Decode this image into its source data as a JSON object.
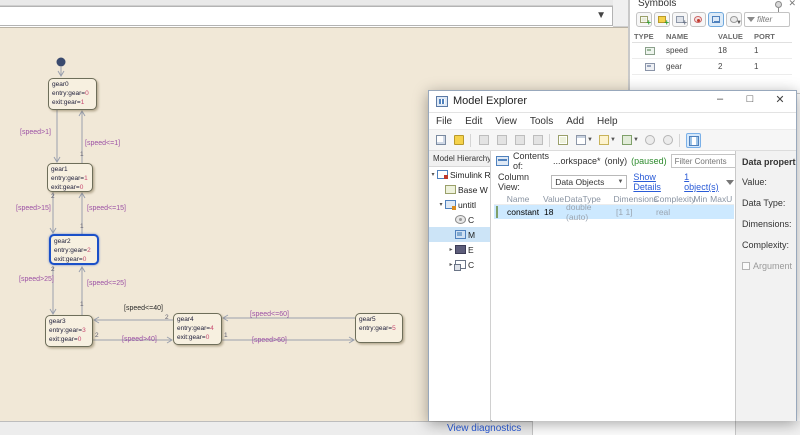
{
  "editor": {
    "status_link": "View diagnostics"
  },
  "chart": {
    "states": [
      {
        "title": "gear0",
        "l1": "entry:gear=",
        "v1": "0",
        "l2": "exit:gear=",
        "v2": "1"
      },
      {
        "title": "gear1",
        "l1": "entry:gear=",
        "v1": "1",
        "l2": "exit:gear=",
        "v2": "0"
      },
      {
        "title": "gear2",
        "l1": "entry:gear=",
        "v1": "2",
        "l2": "exit:gear=",
        "v2": "0"
      },
      {
        "title": "gear3",
        "l1": "entry:gear=",
        "v1": "3",
        "l2": "exit:gear=",
        "v2": "0"
      },
      {
        "title": "gear4",
        "l1": "entry:gear=",
        "v1": "4",
        "l2": "exit:gear=",
        "v2": "0"
      },
      {
        "title": "gear5",
        "l1": "entry:gear=",
        "v1": "5"
      }
    ],
    "transitions": [
      {
        "label": "[speed>1]"
      },
      {
        "label": "[speed<=1]"
      },
      {
        "label": "[speed>15]"
      },
      {
        "label": "[speed<=15]"
      },
      {
        "label": "[speed>25]"
      },
      {
        "label": "[speed<=25]"
      },
      {
        "label": "[speed<=40]"
      },
      {
        "label": "[speed>40]"
      },
      {
        "label": "[speed<=60]"
      },
      {
        "label": "[speed>60]"
      }
    ],
    "order_numbers": [
      "1",
      "2",
      "1",
      "2",
      "1",
      "2",
      "2",
      "1"
    ]
  },
  "symbols": {
    "title": "Symbols",
    "filter_placeholder": "filter",
    "columns": [
      "TYPE",
      "NAME",
      "VALUE",
      "PORT"
    ],
    "rows": [
      {
        "name": "speed",
        "value": "18",
        "port": "1"
      },
      {
        "name": "gear",
        "value": "2",
        "port": "1"
      }
    ]
  },
  "model_explorer": {
    "title": "Model Explorer",
    "controls": {
      "minimize": "–",
      "maximize": "□",
      "close": "✕"
    },
    "menus": [
      "File",
      "Edit",
      "View",
      "Tools",
      "Add",
      "Help"
    ],
    "hierarchy_title": "Model Hierarchy »",
    "tree": [
      {
        "label": "Simulink R"
      },
      {
        "label": "Base W"
      },
      {
        "label": "untitl"
      },
      {
        "label": "C"
      },
      {
        "label": "M"
      },
      {
        "label": "E"
      },
      {
        "label": "C"
      }
    ],
    "contents": {
      "label": "Contents of:",
      "scope": "...orkspace*",
      "only": "(only)",
      "paused": "(paused)",
      "filter_placeholder": "Filter Contents",
      "column_view_label": "Column View:",
      "column_view_value": "Data Objects",
      "show_details": "Show Details",
      "object_count": "1 object(s)",
      "columns": [
        "Name",
        "Value",
        "DataType",
        "Dimensions",
        "Complexity",
        "Min",
        "Max",
        "U"
      ],
      "rows": [
        {
          "name": "constant",
          "value": "18",
          "datatype": "double (auto)",
          "dimensions": "[1 1]",
          "complexity": "real"
        }
      ]
    },
    "properties": {
      "title": "Data properti",
      "fields": [
        "Value:",
        "Data Type:",
        "Dimensions:",
        "Complexity:"
      ],
      "argument_label": "Argument"
    }
  }
}
